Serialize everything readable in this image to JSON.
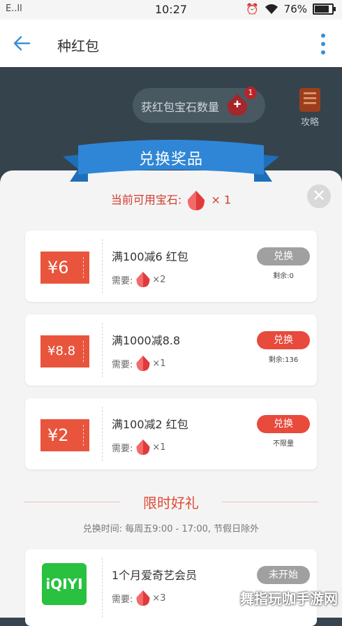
{
  "status_bar": {
    "carrier": "E..ll",
    "time": "10:27",
    "battery": "76%"
  },
  "app_bar": {
    "title": "种红包"
  },
  "background": {
    "gem_label": "获红包宝石数量",
    "gem_badge": "1",
    "guide_label": "攻略"
  },
  "dialog": {
    "title": "兑换奖品",
    "current_gems_label": "当前可用宝石:",
    "current_gems_count": "× 1",
    "need_label": "需要:",
    "rewards": [
      {
        "coupon": "¥6",
        "name": "满100减6 红包",
        "need": "×2",
        "button": "兑换",
        "button_state": "disabled",
        "remain": "剩余:0"
      },
      {
        "coupon": "¥8.8",
        "name": "满1000减8.8",
        "need": "×1",
        "button": "兑换",
        "button_state": "active",
        "remain": "剩余:136"
      },
      {
        "coupon": "¥2",
        "name": "满100减2 红包",
        "need": "×1",
        "button": "兑换",
        "button_state": "active",
        "remain": "不限量"
      }
    ],
    "limited_section": {
      "title": "限时好礼",
      "time": "兑换时间: 每周五9:00 - 17:00, 节假日除外",
      "item": {
        "icon_text": "iQIYI",
        "name": "1个月爱奇艺会员",
        "need": "×3",
        "button": "未开始"
      }
    }
  },
  "watermark": "舞指玩咖手游网",
  "colors": {
    "accent": "#e84a3c",
    "ribbon": "#2f86d6",
    "disabled": "#a0a0a0",
    "back": "#3b8fd8"
  }
}
